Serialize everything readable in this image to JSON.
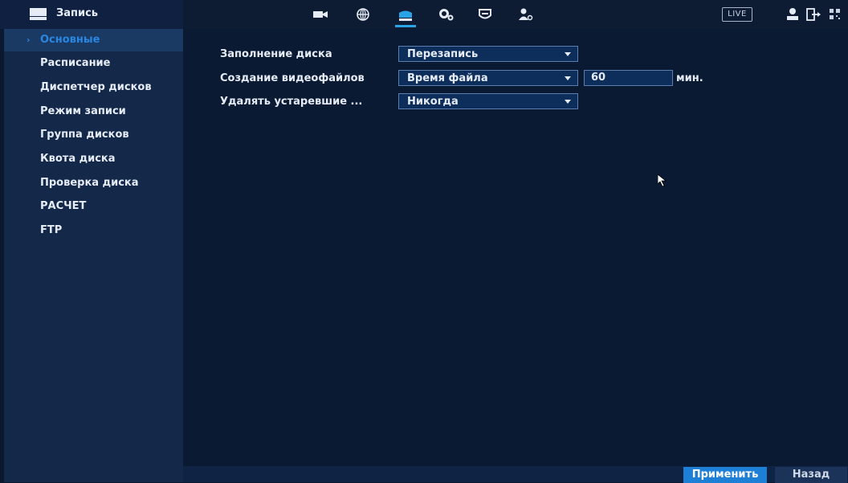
{
  "header": {
    "title": "Запись",
    "live_label": "LIVE",
    "nav_icons": [
      "camera-icon",
      "network-icon",
      "storage-icon",
      "settings-icon",
      "security-icon",
      "account-icon"
    ],
    "active_icon": "storage-icon",
    "right_icons": [
      "user-icon",
      "logout-icon",
      "qr-icon"
    ]
  },
  "sidebar": {
    "items": [
      {
        "label": "Основные",
        "selected": true
      },
      {
        "label": "Расписание"
      },
      {
        "label": "Диспетчер дисков"
      },
      {
        "label": "Режим записи"
      },
      {
        "label": "Группа дисков"
      },
      {
        "label": "Квота диска"
      },
      {
        "label": "Проверка диска"
      },
      {
        "label": "РАСЧЕТ"
      },
      {
        "label": "FTP"
      }
    ]
  },
  "form": {
    "disk_full_label": "Заполнение диска",
    "disk_full_value": "Перезапись",
    "create_files_label": "Создание видеофайлов",
    "create_files_value": "Время файла",
    "file_length_value": "60",
    "file_length_unit": "мин.",
    "delete_old_label": "Удалять устаревшие ...",
    "delete_old_value": "Никогда"
  },
  "footer": {
    "apply_label": "Применить",
    "back_label": "Назад"
  },
  "colors": {
    "accent": "#2a86e0",
    "apply_button": "#1e7fd6",
    "background": "#0b1a33",
    "sidebar": "#14284a"
  }
}
